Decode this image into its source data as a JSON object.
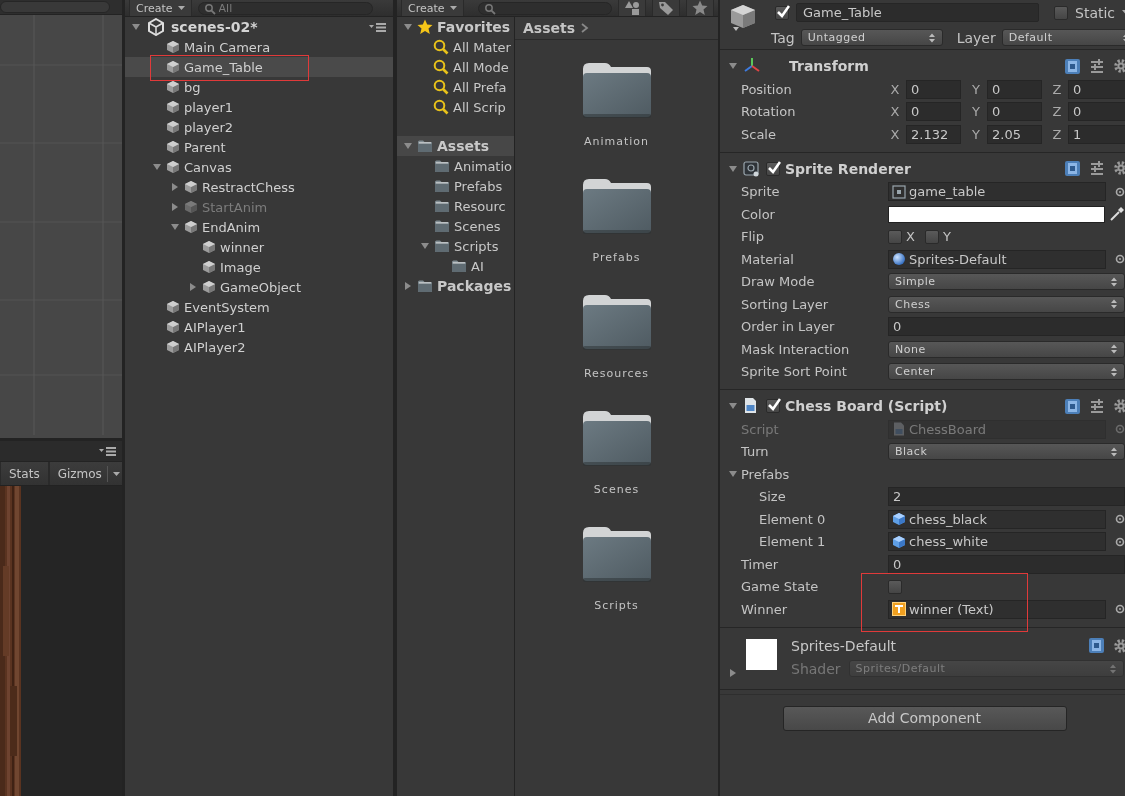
{
  "game_view": {
    "toolbar": [
      {
        "label": "Stats",
        "dropdown": false
      },
      {
        "label": "Gizmos",
        "dropdown": true
      }
    ]
  },
  "hierarchy": {
    "create_button": "Create",
    "search_placeholder": "All",
    "scene": {
      "name": "scenes-02*",
      "expanded": true
    },
    "items": [
      {
        "name": "Main Camera",
        "selected": false,
        "disabled": false,
        "marked": false
      },
      {
        "name": "Game_Table",
        "selected": true,
        "disabled": false,
        "marked": true
      },
      {
        "name": "bg",
        "selected": false,
        "disabled": false,
        "marked": false
      },
      {
        "name": "player1",
        "selected": false,
        "disabled": false,
        "marked": false
      },
      {
        "name": "player2",
        "selected": false,
        "disabled": false,
        "marked": false
      },
      {
        "name": "Parent",
        "selected": false,
        "disabled": false,
        "marked": false
      },
      {
        "name": "Canvas",
        "selected": false,
        "disabled": false,
        "marked": false,
        "expanded": true,
        "children": [
          {
            "name": "RestractChess",
            "selected": false,
            "disabled": false,
            "marked": false,
            "expanded": false
          },
          {
            "name": "StartAnim",
            "selected": false,
            "disabled": true,
            "marked": false,
            "expanded": false
          },
          {
            "name": "EndAnim",
            "selected": false,
            "disabled": false,
            "marked": false,
            "expanded": true,
            "children": [
              {
                "name": "winner",
                "selected": false,
                "disabled": false,
                "marked": false
              },
              {
                "name": "Image",
                "selected": false,
                "disabled": false,
                "marked": false
              },
              {
                "name": "GameObject",
                "selected": false,
                "disabled": false,
                "marked": false,
                "expanded": false
              }
            ]
          }
        ]
      },
      {
        "name": "EventSystem",
        "selected": false,
        "disabled": false,
        "marked": false
      },
      {
        "name": "AIPlayer1",
        "selected": false,
        "disabled": false,
        "marked": false
      },
      {
        "name": "AIPlayer2",
        "selected": false,
        "disabled": false,
        "marked": false
      }
    ]
  },
  "project": {
    "create_button": "Create",
    "favorites": {
      "label": "Favorites",
      "expanded": true,
      "items": [
        "All Mater",
        "All Mode",
        "All Prefa",
        "All Scrip"
      ]
    },
    "tree": [
      {
        "label": "Assets",
        "selected": true,
        "expanded": true,
        "children": [
          {
            "label": "Animatio",
            "selected": false
          },
          {
            "label": "Prefabs",
            "selected": false
          },
          {
            "label": "Resourc",
            "selected": false
          },
          {
            "label": "Scenes",
            "selected": false
          },
          {
            "label": "Scripts",
            "selected": false,
            "expanded": true,
            "children": [
              {
                "label": "AI",
                "selected": false
              }
            ]
          }
        ]
      },
      {
        "label": "Packages",
        "selected": false,
        "expanded": false
      }
    ],
    "breadcrumb": "Assets",
    "folders": [
      "Animation",
      "Prefabs",
      "Resources",
      "Scenes",
      "Scripts"
    ]
  },
  "inspector": {
    "active": true,
    "name": "Game_Table",
    "static": false,
    "static_label": "Static",
    "tag_label": "Tag",
    "tag": "Untagged",
    "layer_label": "Layer",
    "layer": "Default",
    "components": [
      {
        "title": "Transform",
        "kind": "transform",
        "expanded": true,
        "fields": [
          {
            "kind": "vector3",
            "label": "Position",
            "values": [
              {
                "axis": "X",
                "value": "0"
              },
              {
                "axis": "Y",
                "value": "0"
              },
              {
                "axis": "Z",
                "value": "0"
              }
            ]
          },
          {
            "kind": "vector3",
            "label": "Rotation",
            "values": [
              {
                "axis": "X",
                "value": "0"
              },
              {
                "axis": "Y",
                "value": "0"
              },
              {
                "axis": "Z",
                "value": "0"
              }
            ]
          },
          {
            "kind": "vector3",
            "label": "Scale",
            "values": [
              {
                "axis": "X",
                "value": "2.132"
              },
              {
                "axis": "Y",
                "value": "2.05"
              },
              {
                "axis": "Z",
                "value": "1"
              }
            ]
          }
        ]
      },
      {
        "title": "Sprite Renderer",
        "kind": "sprite",
        "enabled": true,
        "expanded": true,
        "fields": [
          {
            "kind": "sprite",
            "label": "Sprite",
            "value": "game_table"
          },
          {
            "kind": "color",
            "label": "Color",
            "color": "#ffffff"
          },
          {
            "kind": "flip",
            "label": "Flip",
            "options": [
              {
                "label": "X",
                "checked": false
              },
              {
                "label": "Y",
                "checked": false
              }
            ]
          },
          {
            "kind": "material",
            "label": "Material",
            "value": "Sprites-Default"
          },
          {
            "kind": "dropdown",
            "label": "Draw Mode",
            "value": "Simple"
          },
          {
            "kind": "dropdown",
            "label": "Sorting Layer",
            "value": "Chess"
          },
          {
            "kind": "number",
            "label": "Order in Layer",
            "value": "0"
          },
          {
            "kind": "dropdown",
            "label": "Mask Interaction",
            "value": "None"
          },
          {
            "kind": "dropdown",
            "label": "Sprite Sort Point",
            "value": "Center"
          }
        ]
      },
      {
        "title": "Chess Board (Script)",
        "kind": "script",
        "enabled": true,
        "expanded": true,
        "fields": [
          {
            "kind": "script",
            "label": "Script",
            "value": "ChessBoard",
            "disabled": true,
            "marked": false
          },
          {
            "kind": "dropdown",
            "label": "Turn",
            "value": "Black",
            "disabled": false,
            "marked": false
          },
          {
            "kind": "foldout",
            "label": "Prefabs",
            "expanded": true,
            "disabled": false,
            "marked": false,
            "children": [
              {
                "kind": "number",
                "label": "Size",
                "value": "2"
              },
              {
                "kind": "prefab",
                "label": "Element 0",
                "value": "chess_black"
              },
              {
                "kind": "prefab",
                "label": "Element 1",
                "value": "chess_white"
              }
            ]
          },
          {
            "kind": "number",
            "label": "Timer",
            "value": "0",
            "disabled": false,
            "marked": false
          },
          {
            "kind": "checkbox",
            "label": "Game State",
            "checked": false,
            "disabled": false,
            "marked": true
          },
          {
            "kind": "text",
            "label": "Winner",
            "value": "winner (Text)",
            "disabled": false,
            "marked": true
          }
        ]
      }
    ],
    "material": {
      "name": "Sprites-Default",
      "expanded": false,
      "shader_label": "Shader",
      "shader": "Sprites/Default"
    },
    "add_component": "Add Component"
  }
}
